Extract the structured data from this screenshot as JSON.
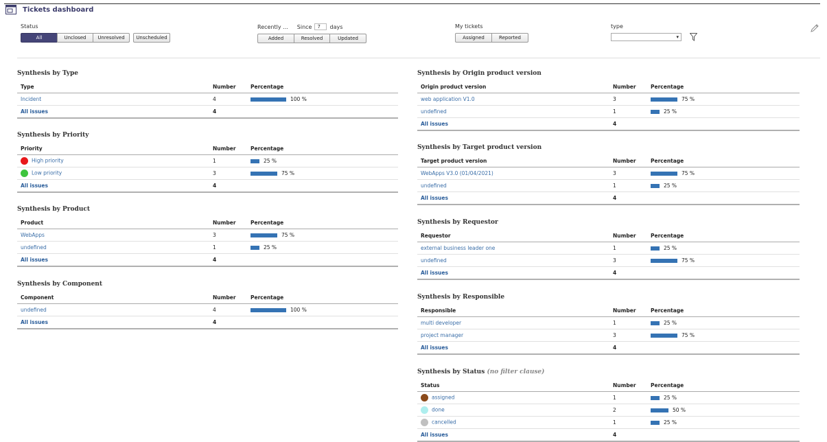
{
  "header": {
    "title": "Tickets dashboard"
  },
  "filters": {
    "status": {
      "label": "Status",
      "buttons": [
        "All",
        "Unclosed",
        "Unresolved"
      ],
      "extra": "Unscheduled",
      "active": "All"
    },
    "recently": {
      "label": "Recently ...",
      "since": "Since",
      "days_value": "7",
      "days_unit": "days",
      "buttons": [
        "Added",
        "Resolved",
        "Updated"
      ]
    },
    "my_tickets": {
      "label": "My tickets",
      "buttons": [
        "Assigned",
        "Reported"
      ]
    },
    "type": {
      "label": "type",
      "value": ""
    }
  },
  "colors": {
    "accent": "#454578",
    "bar": "#3573b4",
    "link": "#3a6ea8"
  },
  "tables": {
    "type": {
      "title": "Synthesis by Type",
      "col1": "Type",
      "col2": "Number",
      "col3": "Percentage",
      "rows": [
        {
          "label": "Incident",
          "number": "4",
          "pct": "100 %",
          "ratio": 1.0
        }
      ],
      "all_label": "All issues",
      "all_number": "4"
    },
    "priority": {
      "title": "Synthesis by Priority",
      "col1": "Priority",
      "col2": "Number",
      "col3": "Percentage",
      "rows": [
        {
          "label": "High priority",
          "number": "1",
          "pct": "25 %",
          "ratio": 0.25,
          "dot": "#e8171a"
        },
        {
          "label": "Low priority",
          "number": "3",
          "pct": "75 %",
          "ratio": 0.75,
          "dot": "#3dc43d"
        }
      ],
      "all_label": "All issues",
      "all_number": "4"
    },
    "product": {
      "title": "Synthesis by Product",
      "col1": "Product",
      "col2": "Number",
      "col3": "Percentage",
      "rows": [
        {
          "label": "WebApps",
          "number": "3",
          "pct": "75 %",
          "ratio": 0.75
        },
        {
          "label": "undefined",
          "number": "1",
          "pct": "25 %",
          "ratio": 0.25
        }
      ],
      "all_label": "All issues",
      "all_number": "4"
    },
    "component": {
      "title": "Synthesis by Component",
      "col1": "Component",
      "col2": "Number",
      "col3": "Percentage",
      "rows": [
        {
          "label": "undefined",
          "number": "4",
          "pct": "100 %",
          "ratio": 1.0
        }
      ],
      "all_label": "All issues",
      "all_number": "4"
    },
    "origin": {
      "title": "Synthesis by Origin product version",
      "col1": "Origin product version",
      "col2": "Number",
      "col3": "Percentage",
      "rows": [
        {
          "label": "web application V1.0",
          "number": "3",
          "pct": "75 %",
          "ratio": 0.75
        },
        {
          "label": "undefined",
          "number": "1",
          "pct": "25 %",
          "ratio": 0.25
        }
      ],
      "all_label": "All issues",
      "all_number": "4"
    },
    "target": {
      "title": "Synthesis by Target product version",
      "col1": "Target product version",
      "col2": "Number",
      "col3": "Percentage",
      "rows": [
        {
          "label": "WebApps V3.0 (01/04/2021)",
          "number": "3",
          "pct": "75 %",
          "ratio": 0.75
        },
        {
          "label": "undefined",
          "number": "1",
          "pct": "25 %",
          "ratio": 0.25
        }
      ],
      "all_label": "All issues",
      "all_number": "4"
    },
    "requestor": {
      "title": "Synthesis by Requestor",
      "col1": "Requestor",
      "col2": "Number",
      "col3": "Percentage",
      "rows": [
        {
          "label": "external business leader one",
          "number": "1",
          "pct": "25 %",
          "ratio": 0.25
        },
        {
          "label": "undefined",
          "number": "3",
          "pct": "75 %",
          "ratio": 0.75
        }
      ],
      "all_label": "All issues",
      "all_number": "4"
    },
    "responsible": {
      "title": "Synthesis by Responsible",
      "col1": "Responsible",
      "col2": "Number",
      "col3": "Percentage",
      "rows": [
        {
          "label": "multi developer",
          "number": "1",
          "pct": "25 %",
          "ratio": 0.25
        },
        {
          "label": "project manager",
          "number": "3",
          "pct": "75 %",
          "ratio": 0.75
        }
      ],
      "all_label": "All issues",
      "all_number": "4"
    },
    "status": {
      "title": "Synthesis by Status",
      "title_note": "(no filter clause)",
      "col1": "Status",
      "col2": "Number",
      "col3": "Percentage",
      "rows": [
        {
          "label": "assigned",
          "number": "1",
          "pct": "25 %",
          "ratio": 0.25,
          "dot": "#8b4a1a"
        },
        {
          "label": "done",
          "number": "2",
          "pct": "50 %",
          "ratio": 0.5,
          "dot": "#aeeeee"
        },
        {
          "label": "cancelled",
          "number": "1",
          "pct": "25 %",
          "ratio": 0.25,
          "dot": "#c0c0c0"
        }
      ],
      "all_label": "All issues",
      "all_number": "4"
    }
  }
}
